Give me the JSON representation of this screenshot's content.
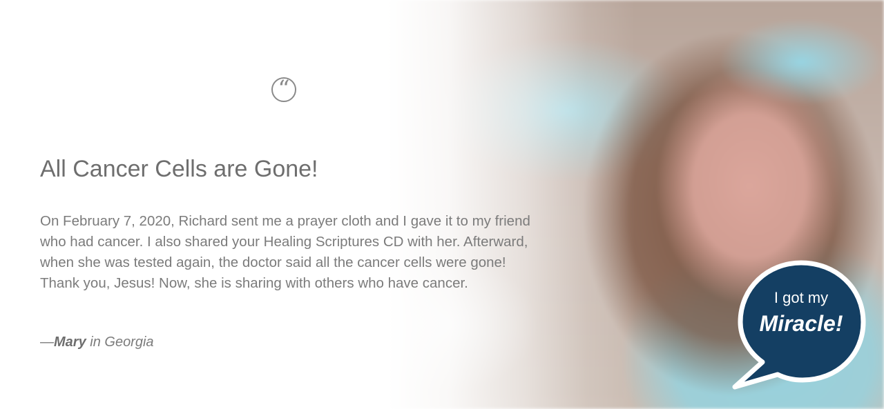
{
  "testimonial": {
    "quote_icon": "quote-icon",
    "title": "All Cancer Cells are Gone!",
    "body": "On February 7, 2020, Richard sent me a prayer cloth and I gave it to my friend who had cancer. I also shared your Healing Scriptures CD with her. Afterward, when she was tested again, the doctor said all the cancer cells were gone! Thank you, Jesus! Now, she is sharing with others who have cancer.",
    "attribution": {
      "dash": "—",
      "name": "Mary",
      "location": " in Georgia"
    }
  },
  "badge": {
    "line1": "I got my",
    "line2": "Miracle!",
    "fill_color": "#143f63",
    "border_color": "#ffffff"
  },
  "colors": {
    "text": "#7b7b7b",
    "title": "#6e6e6e"
  }
}
